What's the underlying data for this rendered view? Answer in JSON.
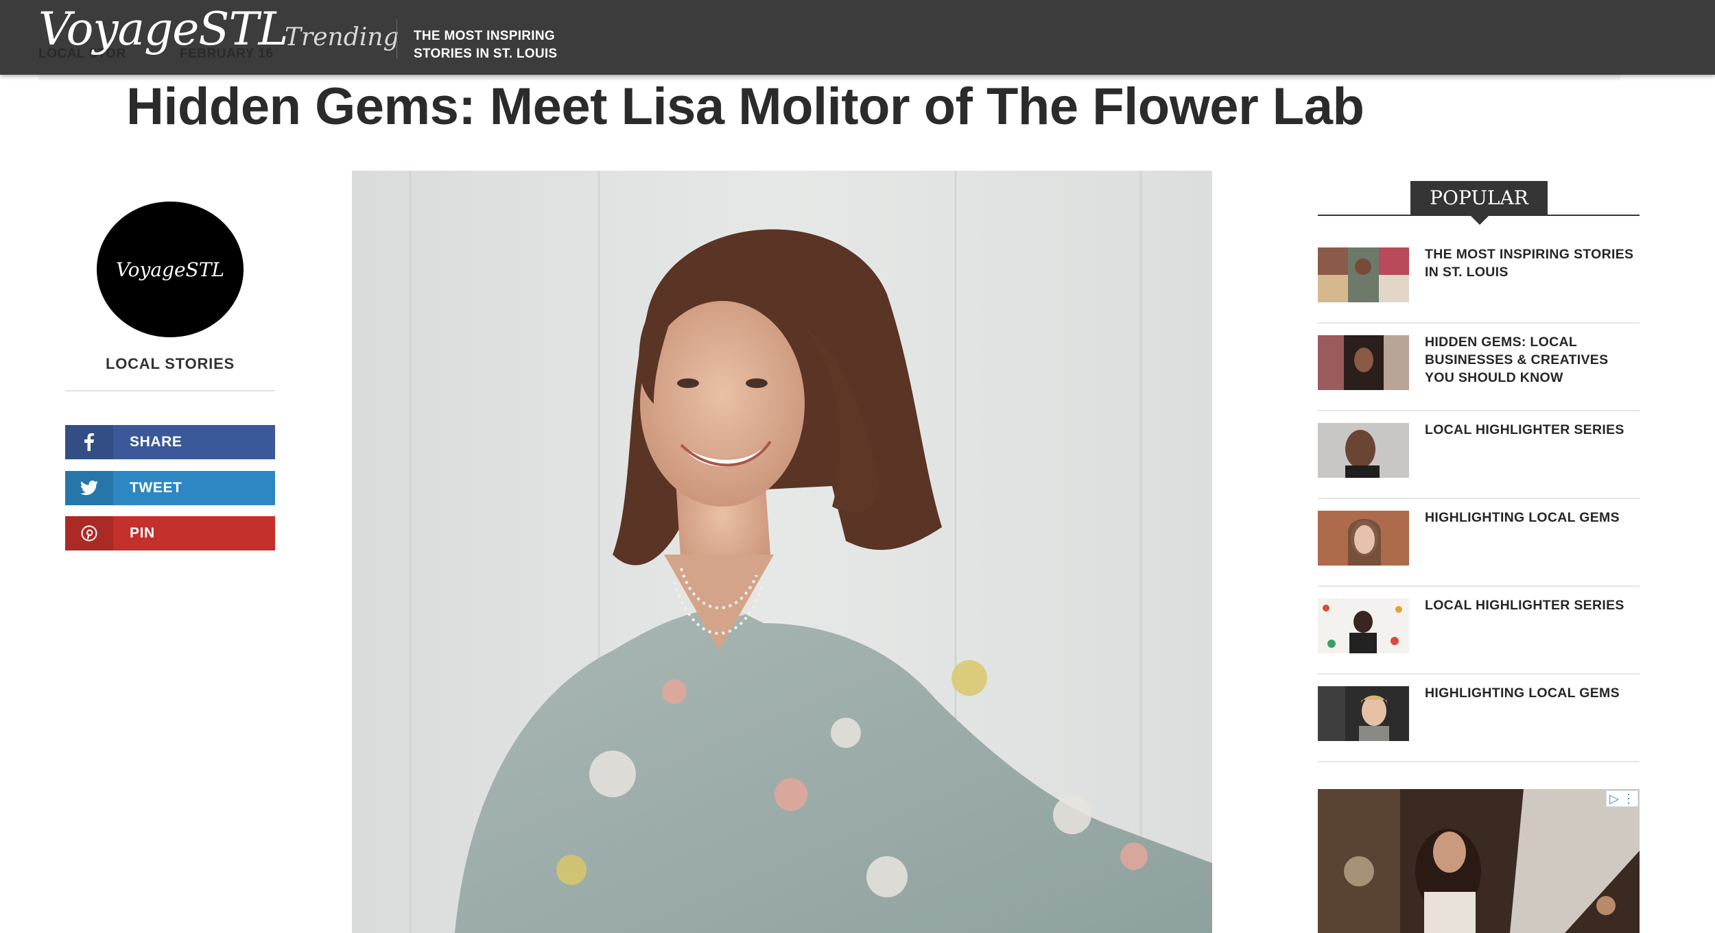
{
  "header": {
    "logo": "VoyageSTL",
    "trending_label": "Trending",
    "trending_story": "THE MOST INSPIRING STORIES IN ST. LOUIS",
    "ghost_category": "LOCAL STOR",
    "ghost_date": "FEBRUARY 16"
  },
  "article": {
    "title": "Hidden Gems: Meet Lisa Molitor of The Flower Lab"
  },
  "author_box": {
    "avatar_text": "VoyageSTL",
    "category": "LOCAL STORIES"
  },
  "share": [
    {
      "label": "SHARE",
      "icon": "facebook-icon",
      "color": "#3b5998"
    },
    {
      "label": "TWEET",
      "icon": "twitter-icon",
      "color": "#2d87c2"
    },
    {
      "label": "PIN",
      "icon": "pinterest-icon",
      "color": "#c4302b"
    }
  ],
  "popular": {
    "heading": "POPULAR",
    "items": [
      {
        "title": "THE MOST INSPIRING STORIES IN ST. LOUIS"
      },
      {
        "title": "HIDDEN GEMS: LOCAL BUSINESSES & CREATIVES YOU SHOULD KNOW"
      },
      {
        "title": "LOCAL HIGHLIGHTER SERIES"
      },
      {
        "title": "HIGHLIGHTING LOCAL GEMS"
      },
      {
        "title": "LOCAL HIGHLIGHTER SERIES"
      },
      {
        "title": "HIGHLIGHTING LOCAL GEMS"
      }
    ]
  },
  "ad": {
    "choices_label": "▷ ⋮"
  }
}
